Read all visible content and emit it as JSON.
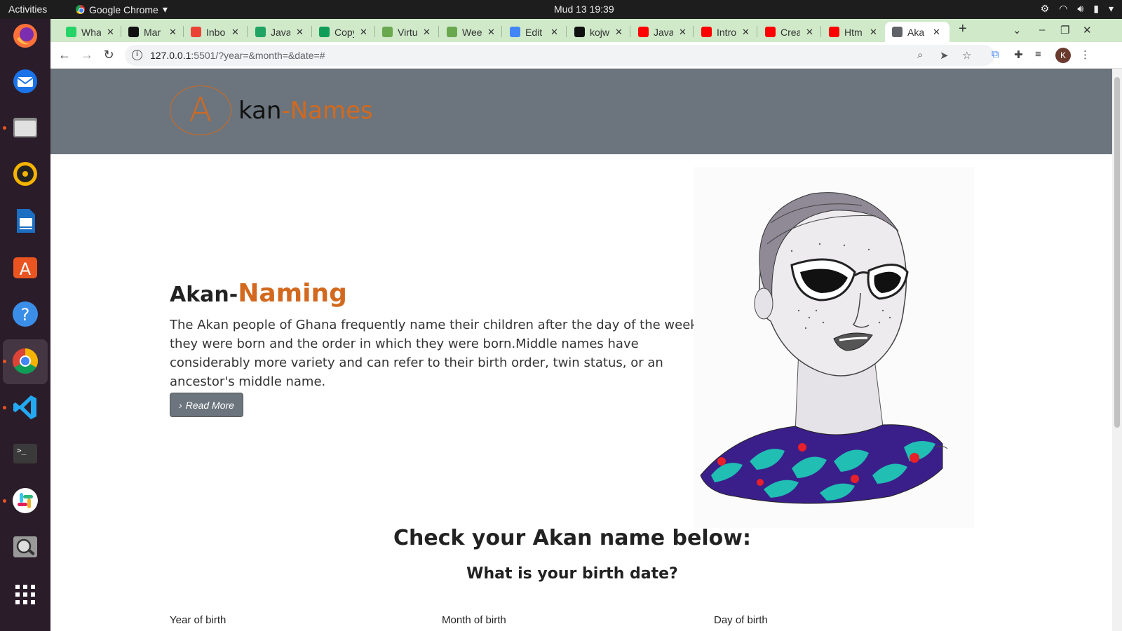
{
  "system": {
    "activities": "Activities",
    "app_name": "Google Chrome",
    "clock": "Mud 13  19:39"
  },
  "dock": {
    "items": [
      "firefox-icon",
      "thunderbird-icon",
      "files-icon",
      "rhythmbox-icon",
      "writer-icon",
      "software-icon",
      "help-icon",
      "chrome-icon",
      "vscode-icon",
      "terminal-icon",
      "slack-icon",
      "screenshot-icon",
      "show-apps-icon"
    ]
  },
  "browser": {
    "tabs": [
      {
        "label": "Wha",
        "icon": "whatsapp-icon",
        "color": "#25d366"
      },
      {
        "label": "Mar",
        "icon": "markdown-icon",
        "color": "#111111"
      },
      {
        "label": "Inbo",
        "icon": "gmail-icon",
        "color": "#ea4335"
      },
      {
        "label": "Java",
        "icon": "drive-icon",
        "color": "#1fa463"
      },
      {
        "label": "Copy",
        "icon": "sheets-icon",
        "color": "#0f9d58"
      },
      {
        "label": "Virtu",
        "icon": "tree-icon",
        "color": "#6aa84f"
      },
      {
        "label": "Wee",
        "icon": "tree-icon",
        "color": "#6aa84f"
      },
      {
        "label": "Edit",
        "icon": "cloud-icon",
        "color": "#4285f4"
      },
      {
        "label": "kojw",
        "icon": "github-icon",
        "color": "#111111"
      },
      {
        "label": "Java",
        "icon": "youtube-icon",
        "color": "#ff0000"
      },
      {
        "label": "Intro",
        "icon": "youtube-icon",
        "color": "#ff0000"
      },
      {
        "label": "Crea",
        "icon": "youtube-icon",
        "color": "#ff0000"
      },
      {
        "label": "Htm",
        "icon": "youtube-icon",
        "color": "#ff0000"
      },
      {
        "label": "Aka",
        "icon": "globe-icon",
        "color": "#5f6368",
        "active": true
      }
    ],
    "url_host": "127.0.0.1",
    "url_rest": ":5501/?year=&month=&date=#",
    "profile_initial": "K"
  },
  "page": {
    "logo_letter": "A",
    "logo_text_dark": "kan",
    "logo_text_accent": "-Names",
    "heading_dark": "Akan-",
    "heading_accent": "Naming",
    "description": "The Akan people of Ghana frequently name their children after the day of the week they were born and the order in which they were born.Middle names have considerably more variety and can refer to their birth order, twin status, or an ancestor's middle name.",
    "read_more": "Read More",
    "check_title": "Check your Akan name below:",
    "check_subtitle": "What is your birth date?",
    "fields": [
      "Year of birth",
      "Month of birth",
      "Day of birth"
    ],
    "accent_color": "#d2691e",
    "band_color": "#6c757d"
  }
}
